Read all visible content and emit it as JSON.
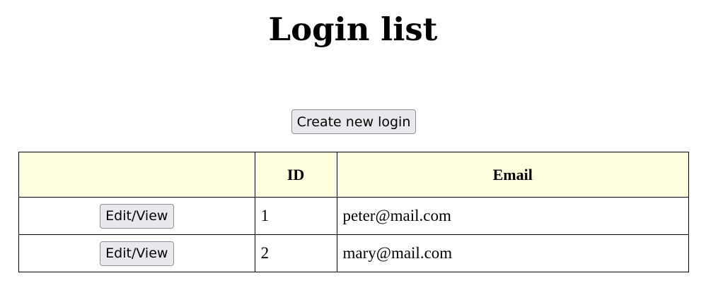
{
  "page": {
    "title": "Login list"
  },
  "toolbar": {
    "create_label": "Create new login"
  },
  "table": {
    "headers": [
      "",
      "ID",
      "Email"
    ],
    "rows": [
      {
        "action_label": "Edit/View",
        "id": "1",
        "email": "peter@mail.com"
      },
      {
        "action_label": "Edit/View",
        "id": "2",
        "email": "mary@mail.com"
      }
    ]
  },
  "colors": {
    "header_bg": "#ffffe0",
    "button_bg": "#e9e9ed",
    "button_border": "#8f8f9d",
    "border": "#000000"
  }
}
